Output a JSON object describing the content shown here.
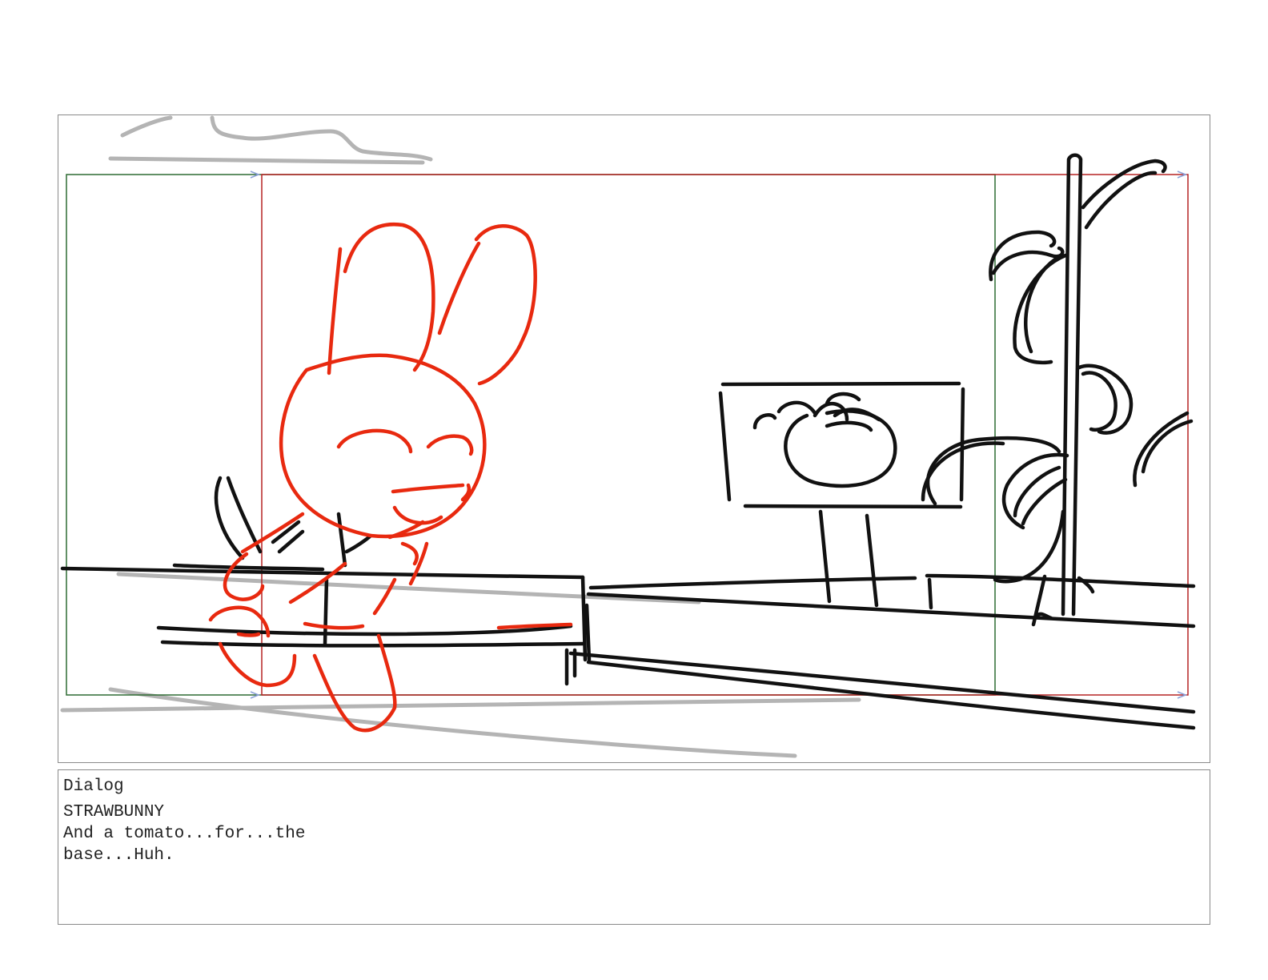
{
  "storyboard": {
    "panel": {
      "image": "storyboard sketch of Strawbunny at a garden bed with a tomato sign and tomato plant on a stake",
      "safe_frame_color": "#b52424",
      "action_frame_color": "#2e6b33",
      "character_sketch_color": "#e8290f",
      "background_sketch_color": "#111111",
      "rough_sketch_color": "#b4b4b4"
    },
    "dialog": {
      "heading": "Dialog",
      "character": "STRAWBUNNY",
      "line": "And a tomato...for...the base...Huh."
    }
  }
}
